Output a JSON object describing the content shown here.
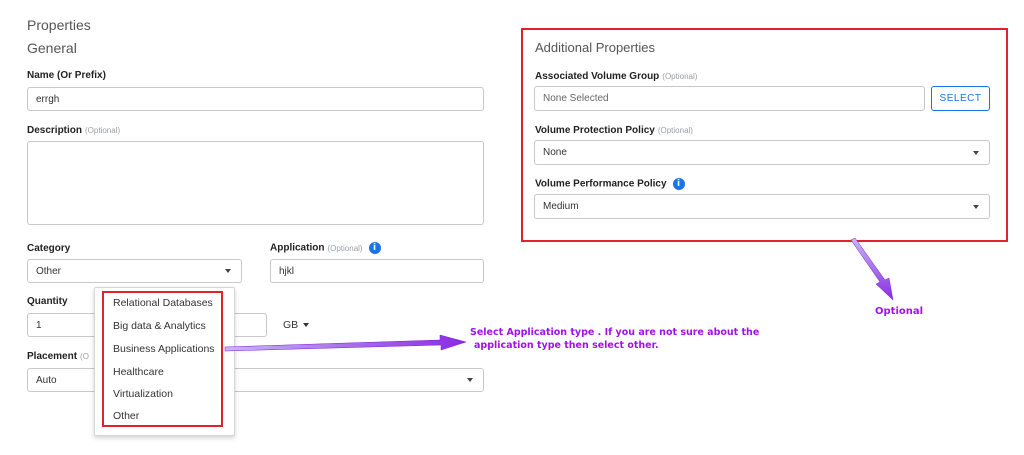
{
  "page": {
    "heading": "Properties",
    "section": "General"
  },
  "form": {
    "name": {
      "label": "Name (Or Prefix)",
      "value": "errgh"
    },
    "description": {
      "label": "Description",
      "optional": "(Optional)",
      "value": ""
    },
    "category": {
      "label": "Category",
      "value": "Other"
    },
    "application": {
      "label": "Application",
      "optional": "(Optional)",
      "value": "hjkl"
    },
    "quantity": {
      "label": "Quantity",
      "value": "1",
      "unit": "GB"
    },
    "placement": {
      "label": "Placement",
      "optional_partial": "(O",
      "value": "Auto"
    }
  },
  "category_dropdown": {
    "options": [
      "Relational Databases",
      "Big data & Analytics",
      "Business Applications",
      "Healthcare",
      "Virtualization",
      "Other"
    ]
  },
  "additional": {
    "title": "Additional Properties",
    "volume_group": {
      "label": "Associated Volume Group",
      "optional": "(Optional)",
      "placeholder": "None Selected",
      "button": "SELECT"
    },
    "protection_policy": {
      "label": "Volume Protection Policy",
      "optional": "(Optional)",
      "value": "None"
    },
    "performance_policy": {
      "label": "Volume Performance Policy",
      "value": "Medium"
    }
  },
  "annotations": {
    "app_type_line1": "Select Application type . If you are not  sure about the",
    "app_type_line2": "application type then select other.",
    "optional": "Optional"
  },
  "colors": {
    "highlight": "#e0222a",
    "callout": "#a012e6",
    "info": "#1a73e8",
    "button": "#1a73e8"
  }
}
